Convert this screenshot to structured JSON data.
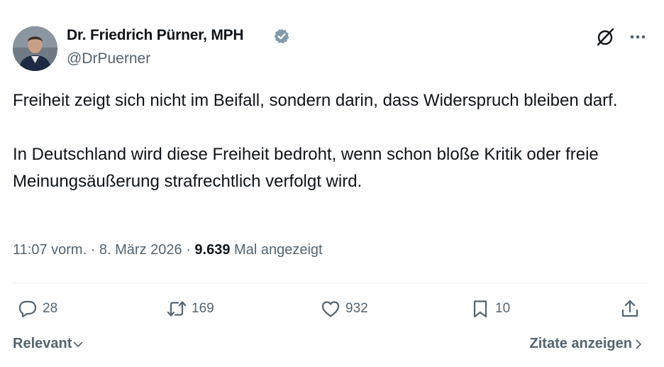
{
  "author": {
    "name": "Dr. Friedrich Pürner, MPH",
    "handle": "@DrPuerner",
    "verified_icon": "verified-badge-icon",
    "verified_color": "#829aab"
  },
  "header_icons": [
    "grok-icon",
    "more-icon"
  ],
  "tweet": {
    "paragraphs": [
      "Freiheit zeigt sich nicht im Beifall, sondern darin, dass Widerspruch bleiben darf.",
      "In Deutschland wird diese Freiheit bedroht, wenn schon bloße Kritik oder freie Meinungsäußerung strafrechtlich verfolgt wird."
    ]
  },
  "meta": {
    "time": "11:07 vorm.",
    "separator1": " · ",
    "date": "8. März 2026",
    "separator2": " · ",
    "views": "9.639",
    "views_label": " Mal angezeigt"
  },
  "actions": {
    "replies": "28",
    "reposts": "169",
    "likes": "932",
    "bookmarks": "10"
  },
  "footer": {
    "sort_label": "Relevant",
    "quotes_label": "Zitate anzeigen"
  },
  "colors": {
    "text": "#0f1419",
    "secondary": "#536471",
    "divider": "#eff3f4"
  }
}
